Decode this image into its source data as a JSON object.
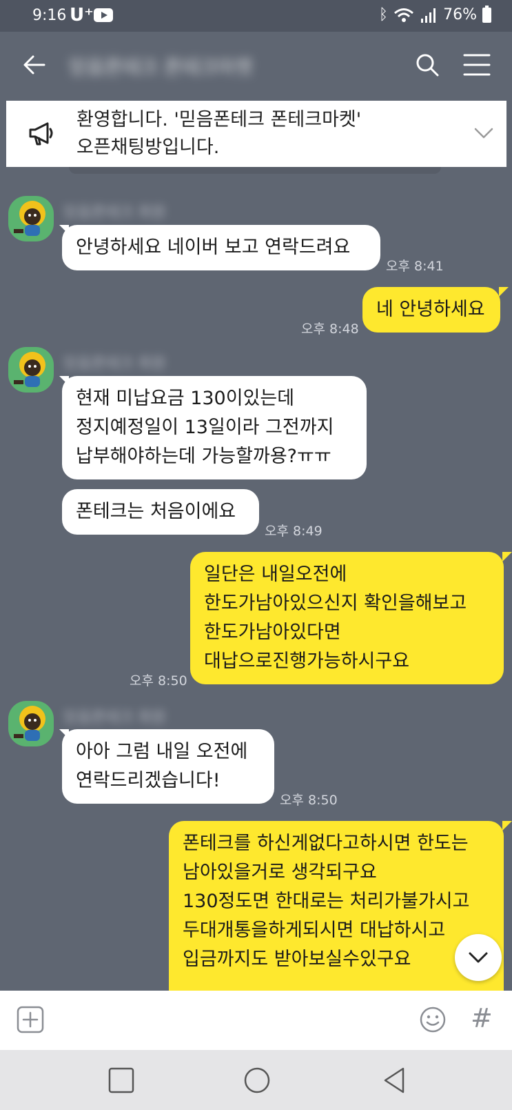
{
  "status_bar": {
    "time": "9:16",
    "carrier": "U⁺",
    "battery": "76%"
  },
  "header": {
    "room_title": "믿음폰테크 폰테크마켓"
  },
  "notice": {
    "text": "환영합니다. '믿음폰테크 폰테크마켓'\n오픈채팅방입니다."
  },
  "messages": [
    {
      "side": "in",
      "sender": "믿음폰테크 회원",
      "text": "안녕하세요 네이버 보고 연락드려요",
      "time": "오후 8:41"
    },
    {
      "side": "out",
      "text": "네 안녕하세요",
      "time": "오후 8:48"
    },
    {
      "side": "in",
      "sender": "믿음폰테크 회원",
      "text": "현재 미납요금 130이있는데\n정지예정일이 13일이라 그전까지\n납부해야하는데 가능할까용?ㅠㅠ",
      "time": ""
    },
    {
      "side": "in",
      "text": "폰테크는 처음이에요",
      "time": "오후 8:49"
    },
    {
      "side": "out",
      "text": "일단은 내일오전에\n한도가남아있으신지 확인을해보고\n한도가남아있다면\n대납으로진행가능하시구요",
      "time": "오후 8:50"
    },
    {
      "side": "in",
      "sender": "믿음폰테크 회원",
      "text": "아아 그럼 내일 오전에\n연락드리겠습니다!",
      "time": "오후 8:50"
    },
    {
      "side": "out",
      "text": "폰테크를 하신게없다고하시면 한도는\n남아있을거로 생각되구요\n130정도면 한대로는 처리가불가시고\n두대개통을하게되시면 대납하시고\n입금까지도 받아보실수있구요",
      "time": ""
    }
  ],
  "input": {
    "placeholder": ""
  },
  "colors": {
    "background": "#5f6672",
    "my_bubble": "#fee82e",
    "their_bubble": "#ffffff"
  }
}
